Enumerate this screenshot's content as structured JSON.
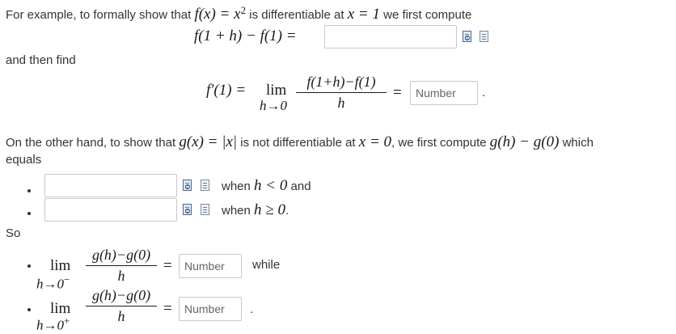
{
  "intro": {
    "lead": "For example, to formally show that",
    "func": "f(x) = x",
    "exp": "2",
    "mid": "is differentiable at",
    "point": "x = 1",
    "tail": "we first compute"
  },
  "eq1": {
    "lhs": "f(1 + h) − f(1) ="
  },
  "then_find": "and then find",
  "eq2": {
    "lhs": "f′(1) =",
    "lim": "lim",
    "sub": "h→0",
    "num": "f(1+h)−f(1)",
    "den": "h",
    "eq": "="
  },
  "other": {
    "lead": "On the other hand, to show that",
    "func": "g(x) = |x|",
    "mid": "is not differentiable at",
    "point": "x = 0",
    "tail1": ", we first compute",
    "expr": "g(h) − g(0)",
    "tail2": "which",
    "line2": "equals"
  },
  "cases": [
    {
      "pre": "when",
      "cond": "h < 0",
      "post": "and"
    },
    {
      "pre": "when",
      "cond": "h ≥ 0",
      "post": "."
    }
  ],
  "so": "So",
  "limits": [
    {
      "lim": "lim",
      "sub": "h→0",
      "sup": "−",
      "num": "g(h)−g(0)",
      "den": "h",
      "eq": "=",
      "after": "while"
    },
    {
      "lim": "lim",
      "sub": "h→0",
      "sup": "+",
      "num": "g(h)−g(0)",
      "den": "h",
      "eq": "=",
      "after": "."
    }
  ],
  "inputs": {
    "number_placeholder": "Number",
    "end_period": "."
  },
  "icons": {
    "preview": "formula-preview-icon",
    "help": "formula-help-icon"
  }
}
